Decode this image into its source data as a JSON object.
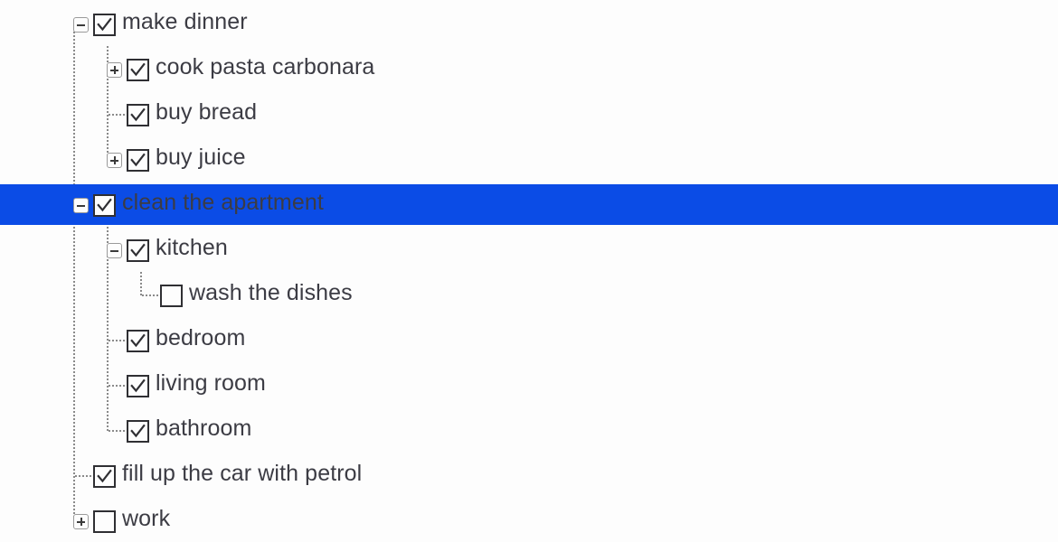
{
  "treeview": {
    "name": "todo-tree",
    "background_color": "#fdfdfd",
    "text_color": "#3c3c44",
    "selection_color": "#0b4ce6",
    "selection_text_color": "#ffffff",
    "rows": [
      {
        "id": "make-dinner",
        "label": "make dinner",
        "level": 0,
        "checked": true,
        "expander": "minus",
        "selected": false
      },
      {
        "id": "cook-pasta-carbonara",
        "label": "cook pasta carbonara",
        "level": 1,
        "checked": true,
        "expander": "plus",
        "selected": false
      },
      {
        "id": "buy-bread",
        "label": "buy bread",
        "level": 1,
        "checked": true,
        "expander": "none",
        "selected": false
      },
      {
        "id": "buy-juice",
        "label": "buy juice",
        "level": 1,
        "checked": true,
        "expander": "plus",
        "selected": false
      },
      {
        "id": "clean-the-apartment",
        "label": "clean the apartment",
        "level": 0,
        "checked": true,
        "expander": "minus",
        "selected": true
      },
      {
        "id": "kitchen",
        "label": "kitchen",
        "level": 1,
        "checked": true,
        "expander": "minus",
        "selected": false
      },
      {
        "id": "wash-the-dishes",
        "label": "wash the dishes",
        "level": 2,
        "checked": false,
        "expander": "none",
        "selected": false
      },
      {
        "id": "bedroom",
        "label": "bedroom",
        "level": 1,
        "checked": true,
        "expander": "none",
        "selected": false
      },
      {
        "id": "living-room",
        "label": "living room",
        "level": 1,
        "checked": true,
        "expander": "none",
        "selected": false
      },
      {
        "id": "bathroom",
        "label": "bathroom",
        "level": 1,
        "checked": true,
        "expander": "none",
        "selected": false
      },
      {
        "id": "fill-up-the-car-with-petrol",
        "label": "fill up the car with petrol",
        "level": 0,
        "checked": true,
        "expander": "none",
        "selected": false
      },
      {
        "id": "work",
        "label": "work",
        "level": 0,
        "checked": false,
        "expander": "plus",
        "selected": false
      }
    ]
  }
}
